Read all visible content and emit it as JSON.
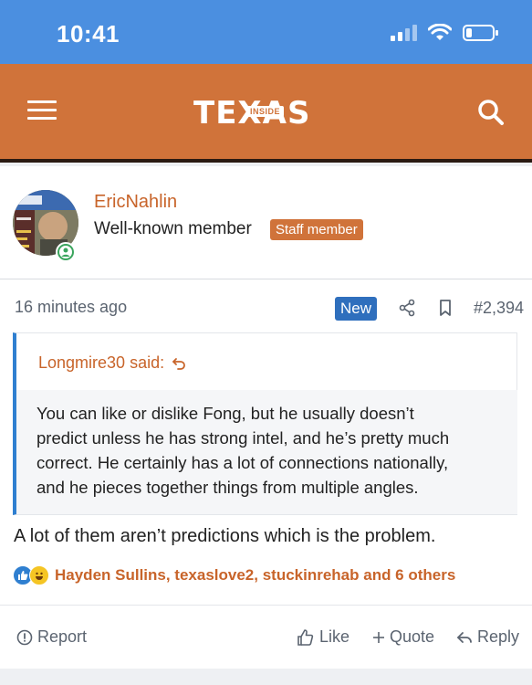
{
  "status_bar": {
    "time": "10:41"
  },
  "header": {
    "logo_text": "TEXAS",
    "logo_badge": "INSIDE"
  },
  "post": {
    "username": "EricNahlin",
    "user_title": "Well-known member",
    "staff_badge": "Staff member",
    "date": "16 minutes ago",
    "new_badge": "New",
    "post_number": "#2,394",
    "quote": {
      "author_label": "Longmire30 said:",
      "lines": [
        "You can like or dislike Fong, but he usually doesn’t",
        "predict unless he has strong intel, and he’s pretty much",
        "correct. He certainly has a lot of connections nationally,",
        "and he pieces together things from multiple angles."
      ]
    },
    "body": "A lot of them aren’t predictions which is the problem.",
    "reactions_text": "Hayden Sullins, texaslove2, stuckinrehab and 6 others",
    "actions": {
      "report": "Report",
      "like": "Like",
      "quote": "Quote",
      "reply": "Reply"
    }
  },
  "colors": {
    "status_bar": "#4b8fe0",
    "header": "#d0733a",
    "link": "#c8642a",
    "new_badge": "#2f6fbd",
    "quote_border": "#2f7fd0"
  }
}
